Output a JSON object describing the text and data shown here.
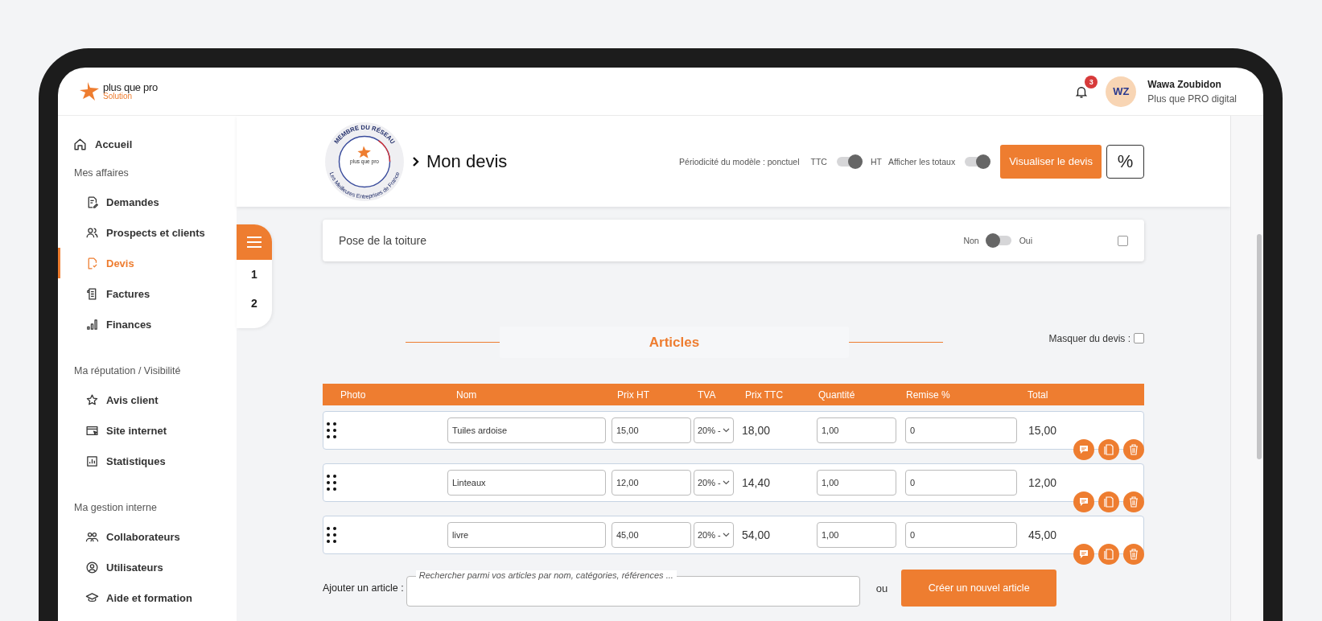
{
  "header": {
    "logo": {
      "name": "plus que pro",
      "tagline": "Solution"
    },
    "notifications": {
      "count": "3"
    },
    "user": {
      "initials": "WZ",
      "name": "Wawa Zoubidon",
      "company": "Plus que PRO digital"
    }
  },
  "sidebar": {
    "home": {
      "label": "Accueil",
      "selected": false
    },
    "sections": [
      {
        "title": "Mes affaires",
        "items": [
          {
            "label": "Demandes",
            "selected": false
          },
          {
            "label": "Prospects et clients",
            "selected": false
          },
          {
            "label": "Devis",
            "selected": true
          },
          {
            "label": "Factures",
            "selected": false
          },
          {
            "label": "Finances",
            "selected": false
          }
        ]
      },
      {
        "title": "Ma réputation / Visibilité",
        "items": [
          {
            "label": "Avis client",
            "selected": false
          },
          {
            "label": "Site internet",
            "selected": false
          },
          {
            "label": "Statistiques",
            "selected": false
          }
        ]
      },
      {
        "title": "Ma gestion interne",
        "items": [
          {
            "label": "Collaborateurs",
            "selected": false
          },
          {
            "label": "Utilisateurs",
            "selected": false
          },
          {
            "label": "Aide et formation",
            "selected": false
          }
        ]
      }
    ]
  },
  "quote_header": {
    "seal": {
      "top_text": "MEMBRE DU RÉSEAU",
      "bottom_text": "Les Meilleures Entreprises de France",
      "brand": "plus que pro"
    },
    "title": "Mon devis",
    "periodicity": "Périodicité du modèle : ponctuel",
    "price_mode": {
      "left": "TTC",
      "right": "HT",
      "on": true
    },
    "totals_toggle": {
      "label": "Afficher les totaux",
      "on": true
    },
    "preview_button": "Visualiser le devis",
    "discount_button": "%"
  },
  "section_nav": {
    "items": [
      "1",
      "2"
    ]
  },
  "section": {
    "title": "Pose de la toiture",
    "option": {
      "off_label": "Non",
      "on_label": "Oui",
      "on": false
    },
    "checked": false
  },
  "articles": {
    "title": "Articles",
    "hide": {
      "label": "Masquer du devis :",
      "checked": false
    },
    "columns": [
      "Photo",
      "Nom",
      "Prix HT",
      "TVA",
      "Prix TTC",
      "Quantité",
      "Remise %",
      "Total"
    ],
    "rows": [
      {
        "name": "Tuiles ardoise",
        "price_ht": "15,00",
        "vat": "20% -",
        "price_ttc": "18,00",
        "quantity": "1,00",
        "discount": "0",
        "total": "15,00"
      },
      {
        "name": "Linteaux",
        "price_ht": "12,00",
        "vat": "20% -",
        "price_ttc": "14,40",
        "quantity": "1,00",
        "discount": "0",
        "total": "12,00"
      },
      {
        "name": "livre",
        "price_ht": "45,00",
        "vat": "20% -",
        "price_ttc": "54,00",
        "quantity": "1,00",
        "discount": "0",
        "total": "45,00"
      }
    ],
    "add": {
      "label": "Ajouter un article :",
      "search_label": "Rechercher parmi vos articles par nom, catégories, références ...",
      "separator": "ou",
      "create_button": "Créer un nouvel article"
    }
  }
}
